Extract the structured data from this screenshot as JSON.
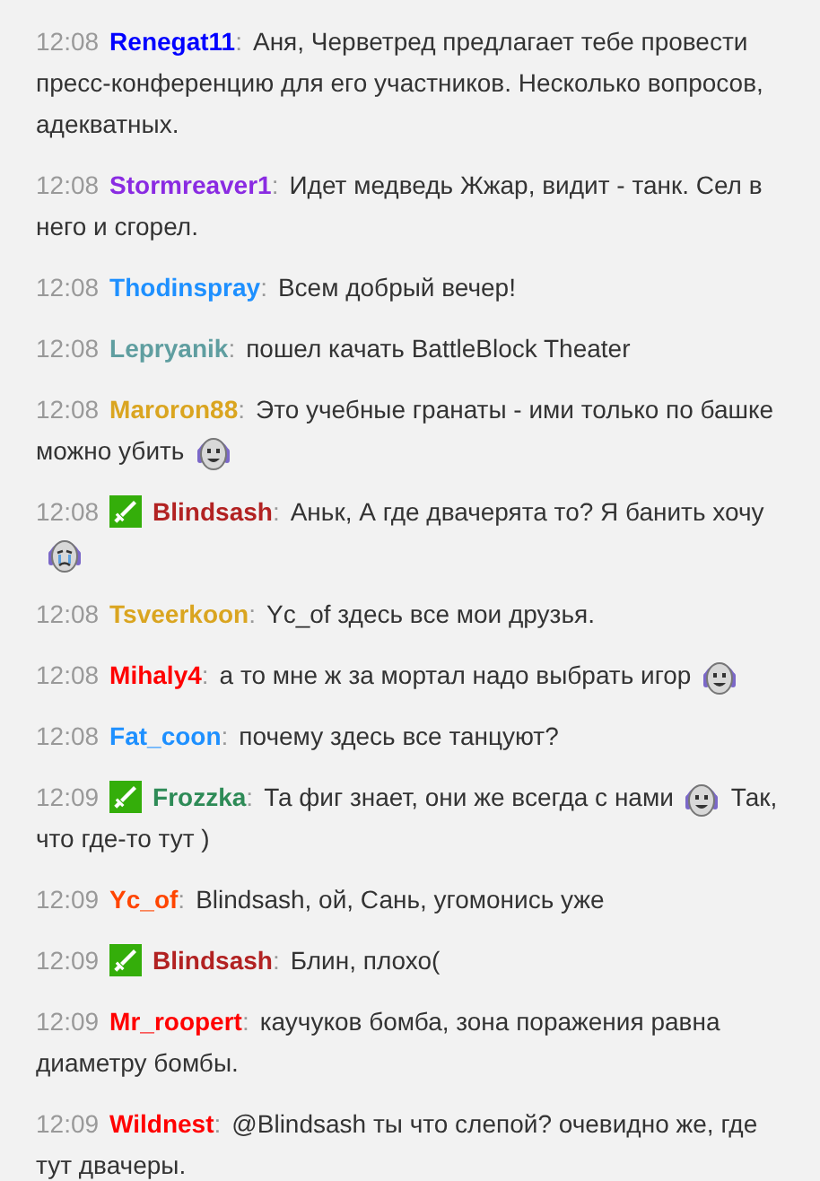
{
  "separator": ":",
  "messages": [
    {
      "time": "12:08",
      "user": "Renegat11",
      "color": "#0000ff",
      "moderator": false,
      "parts": [
        {
          "kind": "text",
          "text": "Аня, Черветред предлагает тебе провести пресс-конференцию для его участников. Несколько вопросов, адекватных."
        }
      ]
    },
    {
      "time": "12:08",
      "user": "Stormreaver1",
      "color": "#8a2be2",
      "moderator": false,
      "parts": [
        {
          "kind": "text",
          "text": "Идет медведь Жжар, видит - танк. Сел в него и сгорел."
        }
      ]
    },
    {
      "time": "12:08",
      "user": "Thodinspray",
      "color": "#1e90ff",
      "moderator": false,
      "parts": [
        {
          "kind": "text",
          "text": "Всем добрый вечер!"
        }
      ]
    },
    {
      "time": "12:08",
      "user": "Lepryanik",
      "color": "#5f9ea0",
      "moderator": false,
      "parts": [
        {
          "kind": "text",
          "text": "пошел качать BattleBlock Theater"
        }
      ]
    },
    {
      "time": "12:08",
      "user": "Maroron88",
      "color": "#daa520",
      "moderator": false,
      "parts": [
        {
          "kind": "text",
          "text": "Это учебные гранаты - ими только по башке можно убить"
        },
        {
          "kind": "smile"
        }
      ]
    },
    {
      "time": "12:08",
      "user": "Blindsash",
      "color": "#b22222",
      "moderator": true,
      "parts": [
        {
          "kind": "text",
          "text": "Аньк, А где двачерята то? Я банить хочу"
        },
        {
          "kind": "sad"
        }
      ]
    },
    {
      "time": "12:08",
      "user": "Tsveerkoon",
      "color": "#daa520",
      "moderator": false,
      "parts": [
        {
          "kind": "text",
          "text": "Yc_of здесь все мои друзья."
        }
      ]
    },
    {
      "time": "12:08",
      "user": "Mihaly4",
      "color": "#ff0000",
      "moderator": false,
      "parts": [
        {
          "kind": "text",
          "text": "а то мне ж за мортал надо выбрать игор"
        },
        {
          "kind": "smile"
        }
      ]
    },
    {
      "time": "12:08",
      "user": "Fat_coon",
      "color": "#1e90ff",
      "moderator": false,
      "parts": [
        {
          "kind": "text",
          "text": "почему здесь все танцуют?"
        }
      ]
    },
    {
      "time": "12:09",
      "user": "Frozzka",
      "color": "#2e8b57",
      "moderator": true,
      "parts": [
        {
          "kind": "text",
          "text": "Та фиг знает, они же всегда с нами"
        },
        {
          "kind": "smile"
        },
        {
          "kind": "text",
          "text": "Так, что где-то тут )"
        }
      ]
    },
    {
      "time": "12:09",
      "user": "Yc_of",
      "color": "#ff4500",
      "moderator": false,
      "parts": [
        {
          "kind": "text",
          "text": "Blindsash, ой, Сань, угомонись уже"
        }
      ]
    },
    {
      "time": "12:09",
      "user": "Blindsash",
      "color": "#b22222",
      "moderator": true,
      "parts": [
        {
          "kind": "text",
          "text": "Блин, плохо("
        }
      ]
    },
    {
      "time": "12:09",
      "user": "Mr_roopert",
      "color": "#ff0000",
      "moderator": false,
      "parts": [
        {
          "kind": "text",
          "text": "каучуков бомба, зона поражения равна диаметру бомбы."
        }
      ]
    },
    {
      "time": "12:09",
      "user": "Wildnest",
      "color": "#ff0000",
      "moderator": false,
      "parts": [
        {
          "kind": "text",
          "text": "@Blindsash ты что слепой? очевидно же, где тут двачеры."
        }
      ]
    }
  ]
}
